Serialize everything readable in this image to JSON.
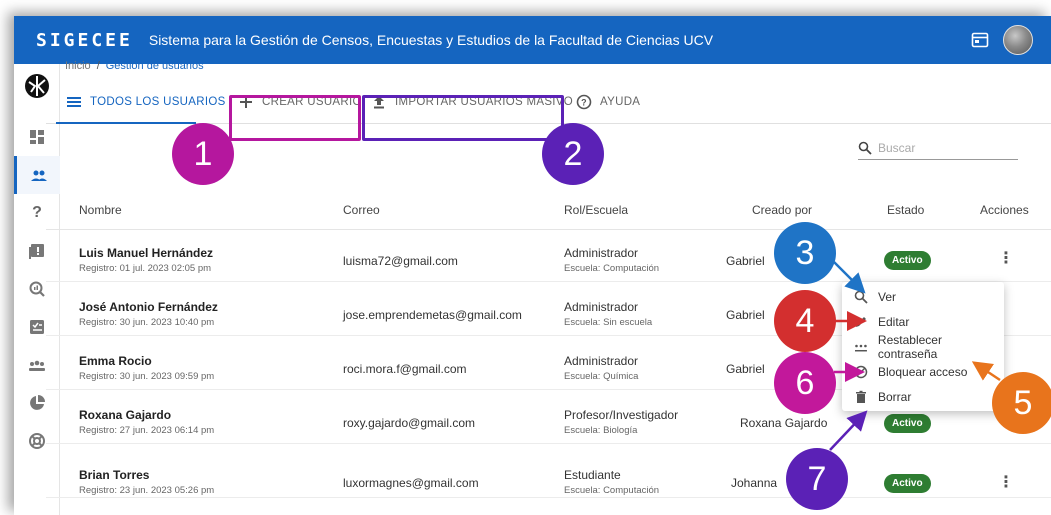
{
  "topbar": {
    "logo": "SIGECEE",
    "title": "Sistema para la Gestión de Censos, Encuestas y Estudios de la Facultad de Ciencias UCV"
  },
  "breadcrumb": {
    "home": "Inicio",
    "separator": "/",
    "current": "Gestión de usuarios"
  },
  "tabs": [
    {
      "label": "TODOS LOS USUARIOS",
      "icon": "list-icon"
    },
    {
      "label": "CREAR USUARIO",
      "icon": "plus-icon"
    },
    {
      "label": "IMPORTAR USUARIOS MASIVO",
      "icon": "upload-icon"
    },
    {
      "label": "AYUDA",
      "icon": "help-circle-icon"
    }
  ],
  "search": {
    "placeholder": "Buscar"
  },
  "table": {
    "headers": [
      "Nombre",
      "Correo",
      "Rol/Escuela",
      "Creado por",
      "Estado",
      "Acciones"
    ],
    "rows": [
      {
        "name": "Luis Manuel Hernández",
        "registered": "Registro: 01 jul. 2023 02:05 pm",
        "email": "luisma72@gmail.com",
        "role": "Administrador",
        "school": "Escuela: Computación",
        "created_by": "Gabriel",
        "status": "Activo"
      },
      {
        "name": "José Antonio Fernández",
        "registered": "Registro: 30 jun. 2023 10:40 pm",
        "email": "jose.emprendemetas@gmail.com",
        "role": "Administrador",
        "school": "Escuela: Sin escuela",
        "created_by": "Gabriel",
        "status": ""
      },
      {
        "name": "Emma Rocio",
        "registered": "Registro: 30 jun. 2023 09:59 pm",
        "email": "roci.mora.f@gmail.com",
        "role": "Administrador",
        "school": "Escuela: Química",
        "created_by": "Gabriel",
        "status": ""
      },
      {
        "name": "Roxana Gajardo",
        "registered": "Registro: 27 jun. 2023 06:14 pm",
        "email": "roxy.gajardo@gmail.com",
        "role": "Profesor/Investigador",
        "school": "Escuela: Biología",
        "created_by": "Roxana Gajardo",
        "status": "Activo"
      },
      {
        "name": "Brian Torres",
        "registered": "Registro: 23 jun. 2023 05:26 pm",
        "email": "luxormagnes@gmail.com",
        "role": "Estudiante",
        "school": "Escuela: Computación",
        "created_by": "Johanna",
        "status": "Activo"
      }
    ]
  },
  "menu": {
    "items": [
      {
        "label": "Ver",
        "icon": "search-icon"
      },
      {
        "label": "Editar",
        "icon": "pencil-icon"
      },
      {
        "label": "Restablecer contraseña",
        "icon": "password-dots-icon"
      },
      {
        "label": "Bloquear acceso",
        "icon": "block-icon"
      },
      {
        "label": "Borrar",
        "icon": "trash-icon"
      }
    ]
  },
  "callouts": [
    "1",
    "2",
    "3",
    "4",
    "5",
    "6",
    "7"
  ],
  "colors": {
    "primary": "#1565c0",
    "active_badge": "#2e7d32",
    "callout_1": "#b5179e",
    "callout_2": "#5b21b6",
    "callout_3": "#1f74c6",
    "callout_4": "#d32f2f",
    "callout_5": "#e8741c",
    "callout_6": "#c2189b",
    "callout_7": "#5b21b6",
    "highlight_1": "#b5179e",
    "highlight_2": "#5b21b6"
  }
}
